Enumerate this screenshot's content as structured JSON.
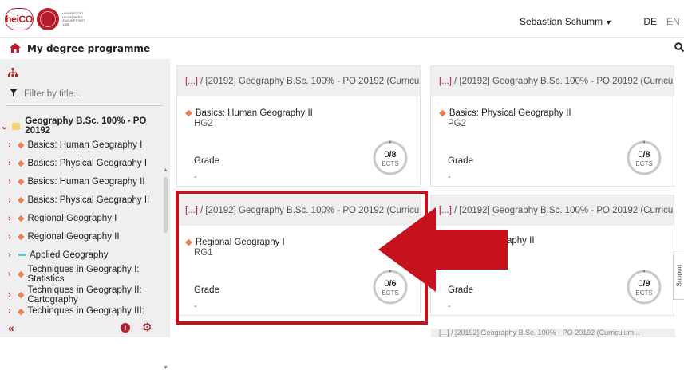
{
  "header": {
    "logo_text": "heiCO",
    "uni_text": "UNIVERSITÄT HEIDELBERG ZUKUNFT SEIT 1386",
    "user_name": "Sebastian Schumm",
    "lang_de": "DE",
    "lang_en": "EN"
  },
  "subbar": {
    "title": "My degree programme"
  },
  "sidebar": {
    "filter_placeholder": "Filter by title...",
    "root": "Geography B.Sc. 100% - PO 20192",
    "items": [
      {
        "label": "Basics: Human Geography I"
      },
      {
        "label": "Basics: Physical Geography I"
      },
      {
        "label": "Basics: Human Geography II"
      },
      {
        "label": "Basics: Physical Geography II"
      },
      {
        "label": "Regional Geography I"
      },
      {
        "label": "Regional Geography II"
      },
      {
        "label": "Applied Geography"
      },
      {
        "label": "Techniques in Geography I: Statistics"
      },
      {
        "label": "Techniques in Geography II: Cartography"
      },
      {
        "label": "Techinques in Geography III:"
      }
    ]
  },
  "cards": [
    {
      "breadcrumb_prefix": "[...]",
      "breadcrumb": "/ [20192] Geography B.Sc. 100% - PO 20192 (Curriculum...",
      "title": "Basics: Human Geography II",
      "code": "HG2",
      "grade_label": "Grade",
      "grade_value": "-",
      "ects_earned": "0",
      "ects_total": "/8",
      "ects_label": "ECTS",
      "progress": 0
    },
    {
      "breadcrumb_prefix": "[...]",
      "breadcrumb": "/ [20192] Geography B.Sc. 100% - PO 20192 (Curriculum...",
      "title": "Basics: Physical Geography II",
      "code": "PG2",
      "grade_label": "Grade",
      "grade_value": "-",
      "ects_earned": "0",
      "ects_total": "/8",
      "ects_label": "ECTS",
      "progress": 0
    },
    {
      "breadcrumb_prefix": "[...]",
      "breadcrumb": "/ [20192] Geography B.Sc. 100% - PO 20192 (Curriculum...",
      "title": "Regional Geography I",
      "code": "RG1",
      "grade_label": "Grade",
      "grade_value": "-",
      "ects_earned": "0",
      "ects_total": "/6",
      "ects_label": "ECTS",
      "progress": 0
    },
    {
      "breadcrumb_prefix": "[...]",
      "breadcrumb": "/ [20192] Geography B.Sc. 100% - PO 20192 (Curriculum...",
      "title": "aphy II",
      "code": "",
      "grade_label": "Grade",
      "grade_value": "-",
      "ects_earned": "0",
      "ects_total": "/9",
      "ects_label": "ECTS",
      "progress": 0
    }
  ],
  "bottom_peek": "[...] / [20192] Geography B.Sc. 100% - PO 20192 (Curriculum...",
  "support": "Support",
  "colors": {
    "accent": "#b71c2a",
    "highlight": "#c5121d",
    "module_diamond": "#e8834f"
  }
}
